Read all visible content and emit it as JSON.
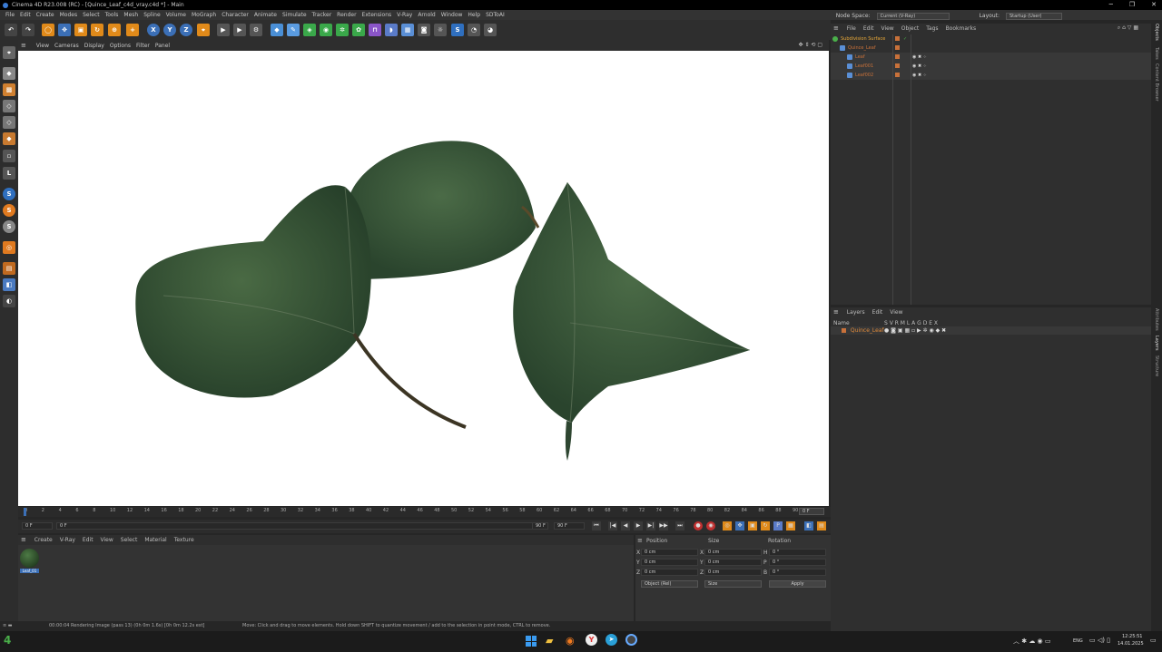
{
  "window": {
    "title": "Cinema 4D R23.008 (RC) - [Quince_Leaf_c4d_vray.c4d *] - Main",
    "minimize": "─",
    "maximize": "❐",
    "close": "✕"
  },
  "menu": [
    "File",
    "Edit",
    "Create",
    "Modes",
    "Select",
    "Tools",
    "Mesh",
    "Spline",
    "Volume",
    "MoGraph",
    "Character",
    "Animate",
    "Simulate",
    "Tracker",
    "Render",
    "Extensions",
    "V-Ray",
    "Arnold",
    "Window",
    "Help",
    "SDToAI"
  ],
  "node_space": {
    "label": "Node Space:",
    "value": "Current (V-Ray)"
  },
  "layout": {
    "label": "Layout:",
    "value": "Startup (User)"
  },
  "toolbar": {
    "x": "X",
    "y": "Y",
    "z": "Z"
  },
  "viewport_menu": [
    "View",
    "Cameras",
    "Display",
    "Options",
    "Filter",
    "Panel"
  ],
  "timeline": {
    "ticks": [
      "0",
      "2",
      "4",
      "6",
      "8",
      "10",
      "12",
      "14",
      "16",
      "18",
      "20",
      "22",
      "24",
      "26",
      "28",
      "30",
      "32",
      "34",
      "36",
      "38",
      "40",
      "42",
      "44",
      "46",
      "48",
      "50",
      "52",
      "54",
      "56",
      "58",
      "60",
      "62",
      "64",
      "66",
      "68",
      "70",
      "72",
      "74",
      "76",
      "78",
      "80",
      "82",
      "84",
      "86",
      "88",
      "90"
    ],
    "current": "0 F",
    "start": "0 F",
    "start2": "0 F",
    "end": "90 F",
    "end2": "90 F"
  },
  "material_menu": [
    "Create",
    "V-Ray",
    "Edit",
    "View",
    "Select",
    "Material",
    "Texture"
  ],
  "material": {
    "name": "Leaf_01"
  },
  "coords": {
    "headers": [
      "Position",
      "Size",
      "Rotation"
    ],
    "rows": [
      {
        "axis": "X",
        "pos": "0 cm",
        "size_axis": "X",
        "size": "0 cm",
        "rot_axis": "H",
        "rot": "0 °"
      },
      {
        "axis": "Y",
        "pos": "0 cm",
        "size_axis": "Y",
        "size": "0 cm",
        "rot_axis": "P",
        "rot": "0 °"
      },
      {
        "axis": "Z",
        "pos": "0 cm",
        "size_axis": "Z",
        "size": "0 cm",
        "rot_axis": "B",
        "rot": "0 °"
      }
    ],
    "mode": "Object (Rel)",
    "size_mode": "Size",
    "apply": "Apply"
  },
  "object_menu": [
    "File",
    "Edit",
    "View",
    "Object",
    "Tags",
    "Bookmarks"
  ],
  "objects": [
    {
      "name": "Subdivision Surface",
      "color": "#e8a838"
    },
    {
      "name": "Quince_Leaf",
      "color": "#c8713a"
    },
    {
      "name": "Leaf",
      "color": "#c8713a"
    },
    {
      "name": "Leaf001",
      "color": "#c8713a"
    },
    {
      "name": "Leaf002",
      "color": "#c8713a"
    }
  ],
  "layers_menu": [
    "Layers",
    "Edit",
    "View"
  ],
  "layers_header": {
    "name": "Name",
    "cols": "S  V  R  M  L  A  G  D  E  X"
  },
  "layers": [
    {
      "name": "Quince_Leaf"
    }
  ],
  "right_tabs_top": [
    "Objects",
    "Takes",
    "Content Browser"
  ],
  "right_tabs_bottom": [
    "Attributes",
    "Layers",
    "Structure"
  ],
  "status": {
    "render": "00:00:04 Rendering Image (pass 13) (0h  0m  1.6s) [0h  0m 12.2s est]",
    "hint": "Move: Click and drag to move elements. Hold down SHIFT to quantize movement / add to the selection in point mode, CTRL to remove."
  },
  "taskbar": {
    "lang": "ENG",
    "time": "12:25:51",
    "date": "14.01.2025",
    "app_number": "4"
  }
}
